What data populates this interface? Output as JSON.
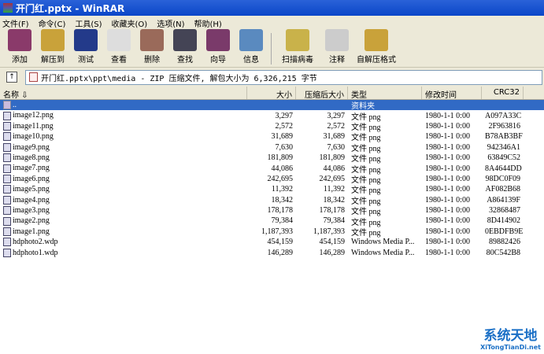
{
  "window": {
    "title": "开门红.pptx - WinRAR"
  },
  "menu": [
    "文件(F)",
    "命令(C)",
    "工具(S)",
    "收藏夹(O)",
    "选项(N)",
    "帮助(H)"
  ],
  "toolbar": [
    {
      "label": "添加",
      "icon": "add-archive-icon",
      "color": "#8a3a6a"
    },
    {
      "label": "解压到",
      "icon": "extract-to-icon",
      "color": "#c9a23a"
    },
    {
      "label": "测试",
      "icon": "test-icon",
      "color": "#233a8a"
    },
    {
      "label": "查看",
      "icon": "view-icon",
      "color": "#ddd"
    },
    {
      "label": "删除",
      "icon": "delete-icon",
      "color": "#9a6a5a"
    },
    {
      "label": "查找",
      "icon": "find-icon",
      "color": "#445"
    },
    {
      "label": "向导",
      "icon": "wizard-icon",
      "color": "#7a3a6a"
    },
    {
      "label": "信息",
      "icon": "info-icon",
      "color": "#5a8abf"
    },
    {
      "label": "扫描病毒",
      "icon": "scan-virus-icon",
      "color": "#c9b24a"
    },
    {
      "label": "注释",
      "icon": "comment-icon",
      "color": "#ccc"
    },
    {
      "label": "自解压格式",
      "icon": "sfx-icon",
      "color": "#c9a23a"
    }
  ],
  "address": {
    "path": "开门红.pptx\\ppt\\media - ZIP 压缩文件, 解包大小为 6,326,215 字节"
  },
  "columns": {
    "name": "名称 ⇩",
    "size": "大小",
    "packed": "压缩后大小",
    "type": "类型",
    "modified": "修改时间",
    "crc": "CRC32"
  },
  "parent": {
    "name": "..",
    "type": "资料夹"
  },
  "files": [
    {
      "name": "image12.png",
      "size": "3,297",
      "packed": "3,297",
      "type": "文件 png",
      "modified": "1980-1-1 0:00",
      "crc": "A097A33C"
    },
    {
      "name": "image11.png",
      "size": "2,572",
      "packed": "2,572",
      "type": "文件 png",
      "modified": "1980-1-1 0:00",
      "crc": "2F963816"
    },
    {
      "name": "image10.png",
      "size": "31,689",
      "packed": "31,689",
      "type": "文件 png",
      "modified": "1980-1-1 0:00",
      "crc": "B78AB3BF"
    },
    {
      "name": "image9.png",
      "size": "7,630",
      "packed": "7,630",
      "type": "文件 png",
      "modified": "1980-1-1 0:00",
      "crc": "942346A1"
    },
    {
      "name": "image8.png",
      "size": "181,809",
      "packed": "181,809",
      "type": "文件 png",
      "modified": "1980-1-1 0:00",
      "crc": "63849C52"
    },
    {
      "name": "image7.png",
      "size": "44,086",
      "packed": "44,086",
      "type": "文件 png",
      "modified": "1980-1-1 0:00",
      "crc": "8A4644DD"
    },
    {
      "name": "image6.png",
      "size": "242,695",
      "packed": "242,695",
      "type": "文件 png",
      "modified": "1980-1-1 0:00",
      "crc": "98DC0F09"
    },
    {
      "name": "image5.png",
      "size": "11,392",
      "packed": "11,392",
      "type": "文件 png",
      "modified": "1980-1-1 0:00",
      "crc": "AF082B68"
    },
    {
      "name": "image4.png",
      "size": "18,342",
      "packed": "18,342",
      "type": "文件 png",
      "modified": "1980-1-1 0:00",
      "crc": "A864139F"
    },
    {
      "name": "image3.png",
      "size": "178,178",
      "packed": "178,178",
      "type": "文件 png",
      "modified": "1980-1-1 0:00",
      "crc": "32868487"
    },
    {
      "name": "image2.png",
      "size": "79,384",
      "packed": "79,384",
      "type": "文件 png",
      "modified": "1980-1-1 0:00",
      "crc": "8D414902"
    },
    {
      "name": "image1.png",
      "size": "1,187,393",
      "packed": "1,187,393",
      "type": "文件 png",
      "modified": "1980-1-1 0:00",
      "crc": "0EBDFB9E"
    },
    {
      "name": "hdphoto2.wdp",
      "size": "454,159",
      "packed": "454,159",
      "type": "Windows Media P...",
      "modified": "1980-1-1 0:00",
      "crc": "89882426"
    },
    {
      "name": "hdphoto1.wdp",
      "size": "146,289",
      "packed": "146,289",
      "type": "Windows Media P...",
      "modified": "1980-1-1 0:00",
      "crc": "80C542B8"
    }
  ],
  "watermark": {
    "title": "系统天地",
    "url": "XiTongTianDi.net"
  }
}
